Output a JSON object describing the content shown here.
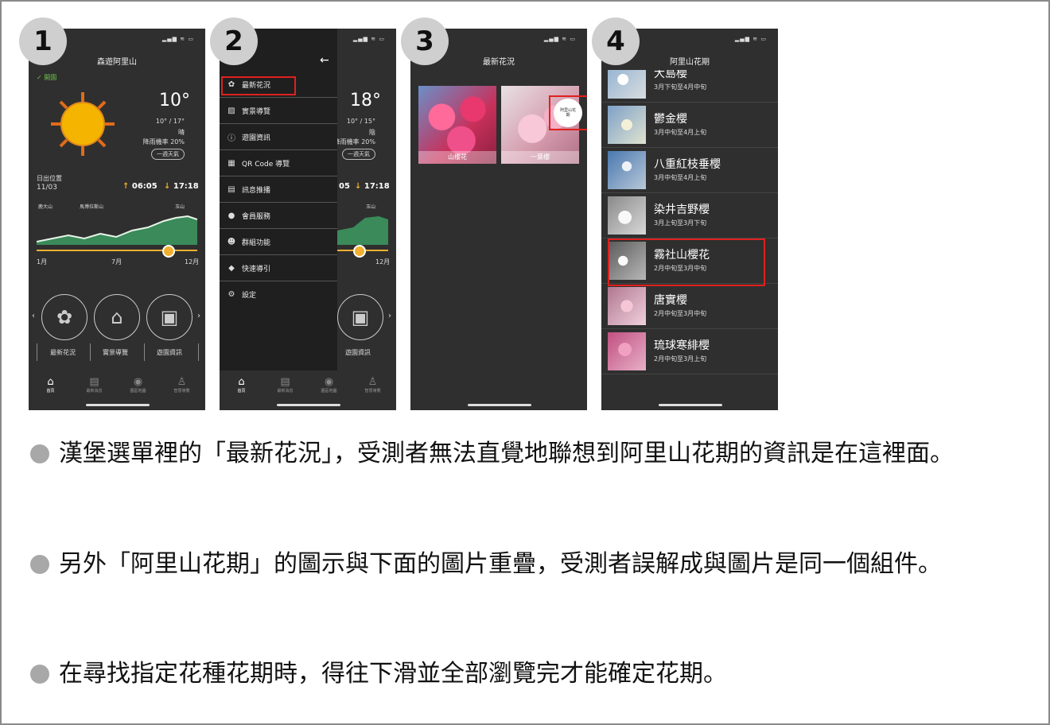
{
  "steps": [
    "1",
    "2",
    "3",
    "4"
  ],
  "status_bar": "▂▄▆ ≋ ▭",
  "phone1": {
    "title": "森遊阿里山",
    "open_label": "開園",
    "temp": "10°",
    "range": "10° / 17°",
    "condition": "晴",
    "rain": "降雨機率 20%",
    "week_button": "一週天氣",
    "sun_label": "日出位置",
    "date": "11/03",
    "sunrise": "06:05",
    "sunset": "17:18",
    "peaks": [
      "鹿大山",
      "馬博拉斯山",
      "玉山"
    ],
    "month_start": "1月",
    "month_mid": "7月",
    "month_end": "12月",
    "features": [
      "最新花況",
      "實景導覽",
      "遊園資訊"
    ],
    "tabs": [
      "首頁",
      "最新消息",
      "園區地圖",
      "智慧導覽"
    ]
  },
  "phone2": {
    "temp": "18°",
    "range": "10° / 15°",
    "condition": "陰",
    "rain": "降雨機率 20%",
    "week_button": "一週天氣",
    "sunrise": "05",
    "sunset": "17:18",
    "peak": "玉山",
    "month_end": "12月",
    "feature": "遊園資訊",
    "menu": [
      {
        "icon": "flower-icon",
        "label": "最新花況"
      },
      {
        "icon": "photo-icon",
        "label": "實景導覽"
      },
      {
        "icon": "info-icon",
        "label": "遊園資訊"
      },
      {
        "icon": "qrcode-icon",
        "label": "QR Code 導覽"
      },
      {
        "icon": "message-icon",
        "label": "訊息推播"
      },
      {
        "icon": "person-icon",
        "label": "會員服務"
      },
      {
        "icon": "group-icon",
        "label": "群組功能"
      },
      {
        "icon": "direction-icon",
        "label": "快速導引"
      },
      {
        "icon": "gear-icon",
        "label": "設定"
      }
    ],
    "tabs": [
      "首頁",
      "最新消息",
      "園區地圖",
      "智慧導覽"
    ]
  },
  "phone3": {
    "title": "最新花況",
    "tiles": [
      "山櫻花",
      "一葉櫻"
    ],
    "badge_text": "阿里山花期"
  },
  "phone4": {
    "title": "阿里山花期",
    "items": [
      {
        "name": "大島櫻",
        "date": "3月下旬至4月中旬"
      },
      {
        "name": "鬱金櫻",
        "date": "3月中旬至4月上旬"
      },
      {
        "name": "八重紅枝垂櫻",
        "date": "3月中旬至4月上旬"
      },
      {
        "name": "染井吉野櫻",
        "date": "3月上旬至3月下旬"
      },
      {
        "name": "霧社山櫻花",
        "date": "2月中旬至3月中旬"
      },
      {
        "name": "唐實櫻",
        "date": "2月中旬至3月中旬"
      },
      {
        "name": "琉球寒緋櫻",
        "date": "2月中旬至3月上旬"
      }
    ]
  },
  "findings": [
    "漢堡選單裡的「最新花況」，受測者無法直覺地聯想到阿里山花期的資訊是在這裡面。",
    "另外「阿里山花期」的圖示與下面的圖片重疊，受測者誤解成與圖片是同一個組件。",
    "在尋找指定花種花期時，得往下滑並全部瀏覽完才能確定花期。"
  ],
  "colors": {
    "highlight": "#e0201e",
    "sun": "#f4b400",
    "slider": "#f0b030",
    "mountain": "#3a8a5a"
  }
}
